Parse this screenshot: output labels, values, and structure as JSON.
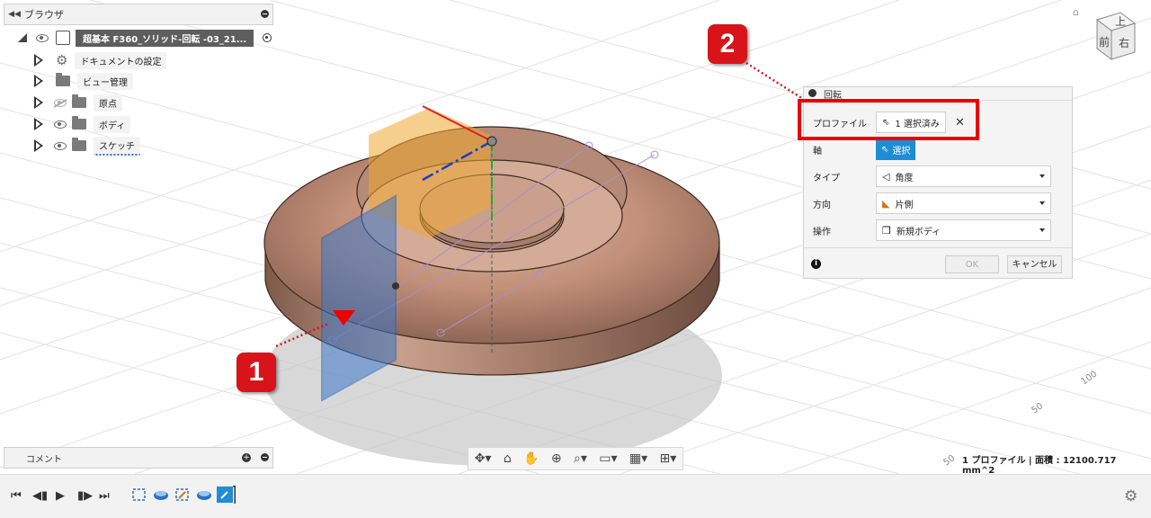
{
  "browser": {
    "title": "ブラウザ"
  },
  "tree": {
    "root": "超基本 F360_ソリッド-回転 -03_21...",
    "items": [
      {
        "label": "ドキュメントの設定",
        "icon": "gear-icon"
      },
      {
        "label": "ビュー管理",
        "icon": "folder-icon"
      },
      {
        "label": "原点",
        "icon": "folder-icon",
        "visible": false
      },
      {
        "label": "ボディ",
        "icon": "folder-icon",
        "visible": true
      },
      {
        "label": "スケッチ",
        "icon": "folder-icon",
        "visible": true
      }
    ]
  },
  "comment": {
    "title": "コメント"
  },
  "dialog": {
    "title": "回転",
    "rows": [
      {
        "label": "プロファイル",
        "value": "1 選択済み"
      },
      {
        "label": "軸",
        "value": "選択"
      },
      {
        "label": "タイプ",
        "value": "角度"
      },
      {
        "label": "方向",
        "value": "片側"
      },
      {
        "label": "操作",
        "value": "新規ボディ"
      }
    ],
    "ok": "OK",
    "cancel": "キャンセル"
  },
  "callouts": {
    "one": "1",
    "two": "2"
  },
  "status": "1 プロファイル | 面積 : 12100.717 mm^2",
  "viewcube": {
    "top": "上",
    "front": "前",
    "right": "右"
  },
  "axis_labels": [
    "100",
    "50",
    "50"
  ],
  "colors": {
    "accent": "#1f8dd6",
    "callout": "#d8141a",
    "body": "#c89a82"
  }
}
